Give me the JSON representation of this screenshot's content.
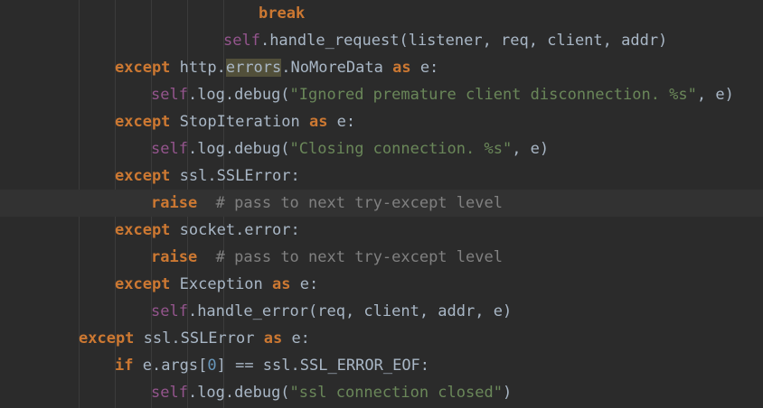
{
  "editor": {
    "lines": [
      [
        {
          "t": "break",
          "c": "kw"
        }
      ],
      [
        {
          "t": "self",
          "c": "self"
        },
        {
          "t": ".handle_request(listener, req, client, addr)",
          "c": ""
        }
      ],
      [
        {
          "t": "except",
          "c": "kw"
        },
        {
          "t": " http.",
          "c": ""
        },
        {
          "t": "errors",
          "c": "hl"
        },
        {
          "t": ".NoMoreData ",
          "c": ""
        },
        {
          "t": "as",
          "c": "kw"
        },
        {
          "t": " e:",
          "c": ""
        }
      ],
      [
        {
          "t": "self",
          "c": "self"
        },
        {
          "t": ".log.debug(",
          "c": ""
        },
        {
          "t": "\"Ignored premature client disconnection. %s\"",
          "c": "str"
        },
        {
          "t": ", e)",
          "c": ""
        }
      ],
      [
        {
          "t": "except",
          "c": "kw"
        },
        {
          "t": " StopIteration ",
          "c": ""
        },
        {
          "t": "as",
          "c": "kw"
        },
        {
          "t": " e:",
          "c": ""
        }
      ],
      [
        {
          "t": "self",
          "c": "self"
        },
        {
          "t": ".log.debug(",
          "c": ""
        },
        {
          "t": "\"Closing connection. %s\"",
          "c": "str"
        },
        {
          "t": ", e)",
          "c": ""
        }
      ],
      [
        {
          "t": "except",
          "c": "kw"
        },
        {
          "t": " ssl.SSLError:",
          "c": ""
        }
      ],
      [
        {
          "t": "raise",
          "c": "kw"
        },
        {
          "t": "  ",
          "c": ""
        },
        {
          "t": "# pass to next try-except level",
          "c": "com"
        }
      ],
      [
        {
          "t": "except",
          "c": "kw"
        },
        {
          "t": " socket.error:",
          "c": ""
        }
      ],
      [
        {
          "t": "raise",
          "c": "kw"
        },
        {
          "t": "  ",
          "c": ""
        },
        {
          "t": "# pass to next try-except level",
          "c": "com"
        }
      ],
      [
        {
          "t": "except",
          "c": "kw"
        },
        {
          "t": " Exception ",
          "c": ""
        },
        {
          "t": "as",
          "c": "kw"
        },
        {
          "t": " e:",
          "c": ""
        }
      ],
      [
        {
          "t": "self",
          "c": "self"
        },
        {
          "t": ".handle_error(req, client, addr, e)",
          "c": ""
        }
      ],
      [
        {
          "t": "except",
          "c": "kw"
        },
        {
          "t": " ssl.SSLError ",
          "c": ""
        },
        {
          "t": "as",
          "c": "kw"
        },
        {
          "t": " e:",
          "c": ""
        }
      ],
      [
        {
          "t": "if",
          "c": "kw"
        },
        {
          "t": " e.args[",
          "c": ""
        },
        {
          "t": "0",
          "c": "num"
        },
        {
          "t": "] == ssl.SSL_ERROR_EOF:",
          "c": ""
        }
      ],
      [
        {
          "t": "self",
          "c": "self"
        },
        {
          "t": ".log.debug(",
          "c": ""
        },
        {
          "t": "\"ssl connection closed\"",
          "c": "str"
        },
        {
          "t": ")",
          "c": ""
        }
      ]
    ]
  }
}
